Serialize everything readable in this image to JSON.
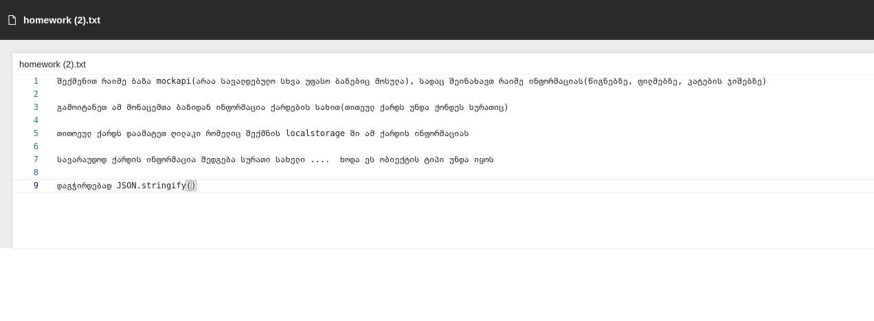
{
  "topbar": {
    "icon": "file-icon",
    "title": "homework (2).txt"
  },
  "panel": {
    "title": "homework (2).txt"
  },
  "editor": {
    "lines": [
      {
        "number": "1",
        "text": "შექმენით რაიმე ბაზა mockapi(არაა სავალდებულო სხვა უფასო ბაზებიც მოსულა), სადაც შეინახავთ რაიმე ინფორმაციას(წიგნებზე, ფილმებზე, კატების ჯიშებზე)"
      },
      {
        "number": "2",
        "text": ""
      },
      {
        "number": "3",
        "text": "გამოიტანეთ ამ მონაცემთა ბაზიდან ინფორმაცია ქარდების სახით(თითეულ ქარდს უნდა ქონდეს სურათიც)"
      },
      {
        "number": "4",
        "text": ""
      },
      {
        "number": "5",
        "text": "თითოეულ ქარდს დაამატეთ ღილაკი რომელიც შექმნის localstorage ში ამ ქარდის ინფორმაციას"
      },
      {
        "number": "6",
        "text": ""
      },
      {
        "number": "7",
        "text": "სავარაუდოდ ქარდის ინფორმაცია შედგება სურათი სახელი ....  ხოდა ეს ობიექტის ტიპი უნდა იყოს"
      },
      {
        "number": "8",
        "text": ""
      },
      {
        "number": "9",
        "text_prefix": "დაგჭირდებად JSON.stringify",
        "bracket_open": "(",
        "bracket_close": ")"
      }
    ]
  }
}
